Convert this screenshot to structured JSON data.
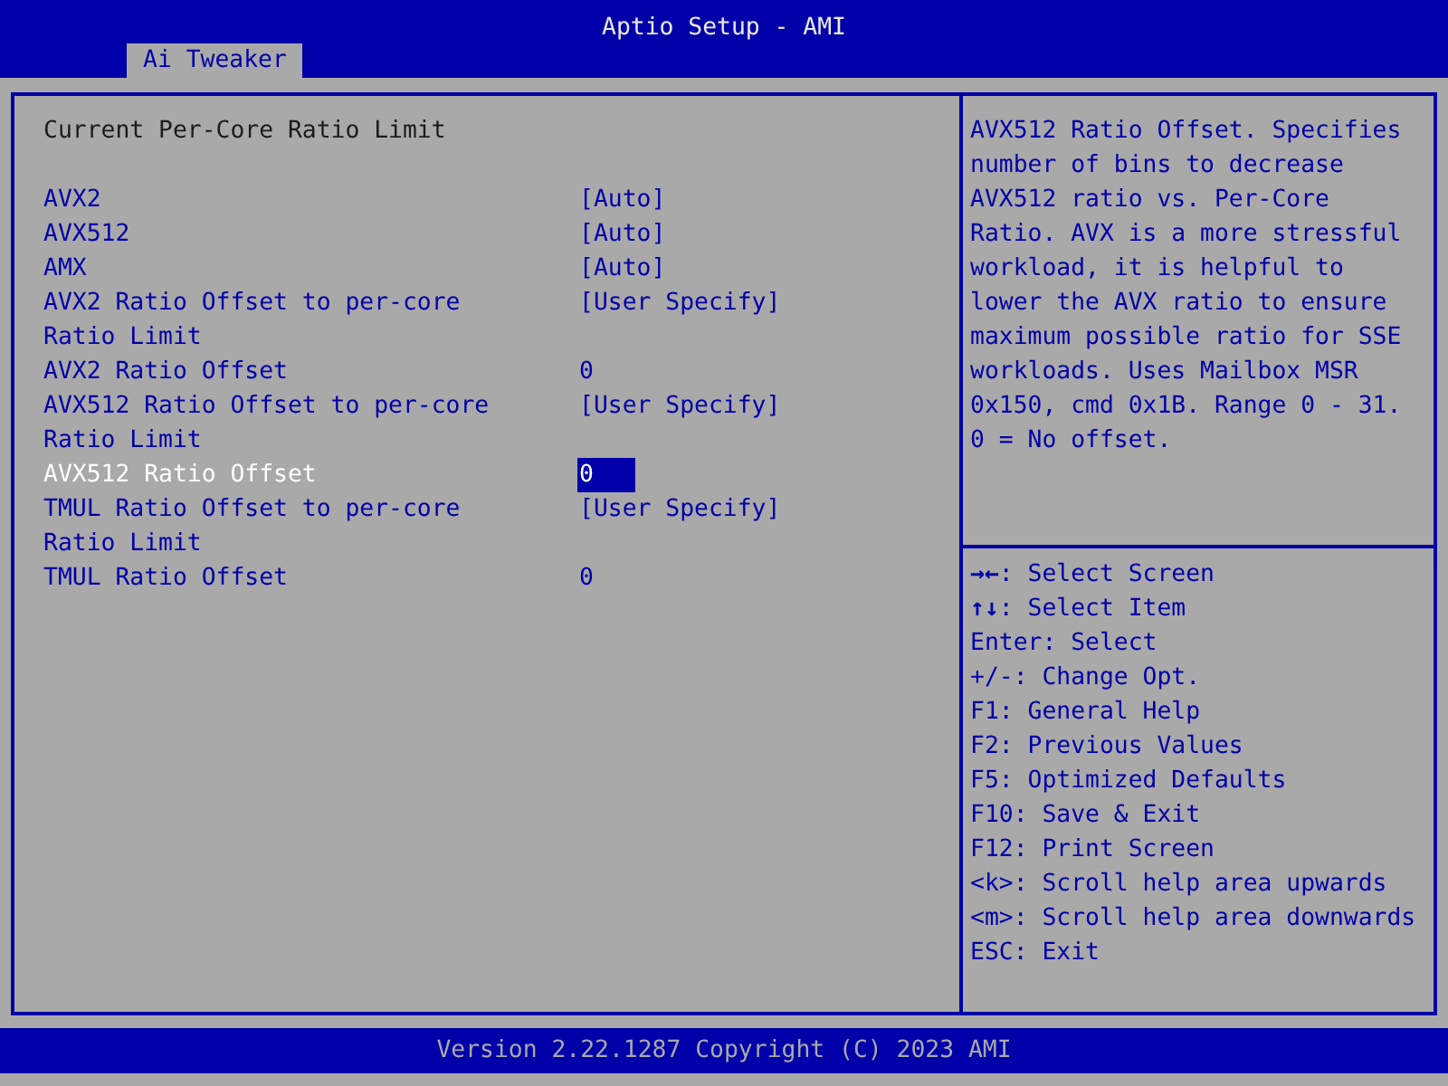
{
  "window": {
    "title": "Aptio Setup - AMI"
  },
  "tabs": [
    {
      "label": "Ai Tweaker",
      "selected": true
    }
  ],
  "settings": [
    {
      "kind": "heading",
      "label": "Current Per-Core Ratio Limit"
    },
    {
      "kind": "spacer"
    },
    {
      "kind": "option",
      "label": "AVX2",
      "value": "[Auto]",
      "selected": false
    },
    {
      "kind": "option",
      "label": "AVX512",
      "value": "[Auto]",
      "selected": false
    },
    {
      "kind": "option",
      "label": "AMX",
      "value": "[Auto]",
      "selected": false
    },
    {
      "kind": "option",
      "label": "AVX2 Ratio Offset to per-core Ratio Limit",
      "value": "[User Specify]",
      "selected": false
    },
    {
      "kind": "option",
      "label": "AVX2 Ratio Offset",
      "value": "0",
      "selected": false
    },
    {
      "kind": "option",
      "label": "AVX512 Ratio Offset to per-core Ratio Limit",
      "value": "[User Specify]",
      "selected": false
    },
    {
      "kind": "option",
      "label": "AVX512 Ratio Offset",
      "value": "0",
      "selected": true
    },
    {
      "kind": "option",
      "label": "TMUL Ratio Offset to per-core Ratio Limit",
      "value": "[User Specify]",
      "selected": false
    },
    {
      "kind": "option",
      "label": "TMUL Ratio Offset",
      "value": "0",
      "selected": false
    }
  ],
  "help_text": "AVX512 Ratio Offset. Specifies number of bins to decrease AVX512 ratio vs. Per-Core Ratio. AVX is a more stressful workload, it is helpful to lower the AVX ratio to ensure maximum possible ratio for SSE workloads. Uses Mailbox MSR 0x150, cmd 0x1B. Range 0 - 31. 0 = No offset.",
  "key_help": [
    "**→←**: Select Screen",
    "**↑↓**: Select Item",
    "Enter: Select",
    "+/-: Change Opt.",
    "F1: General Help",
    "F2: Previous Values",
    "F5: Optimized Defaults",
    "F10: Save & Exit",
    "F12: Print Screen",
    "<k>: Scroll help area upwards",
    "<m>: Scroll help area downwards",
    "ESC: Exit"
  ],
  "status_bar": "Version 2.22.1287 Copyright (C) 2023 AMI"
}
